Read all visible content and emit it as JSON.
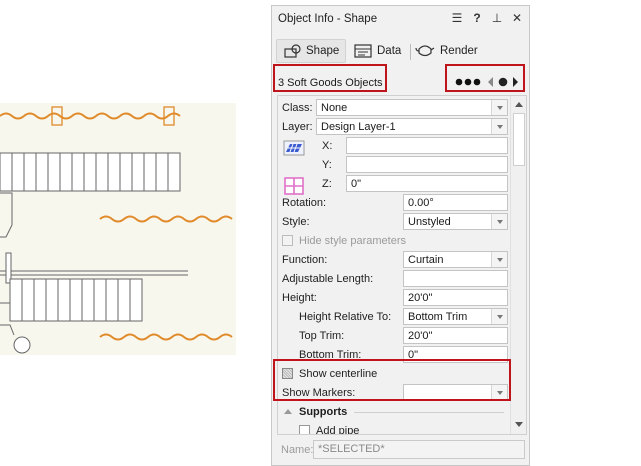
{
  "palette": {
    "title": "Object Info - Shape",
    "tabs": [
      {
        "label": "Shape",
        "icon": "shape-icon"
      },
      {
        "label": "Data",
        "icon": "data-icon"
      },
      {
        "label": "Render",
        "icon": "render-teapot-icon"
      }
    ]
  },
  "header": {
    "selection": "3 Soft Goods Objects",
    "nav_icons": [
      "more-dots-icon",
      "previous-icon",
      "gear-icon",
      "next-icon"
    ]
  },
  "fields": {
    "class": {
      "label": "Class:",
      "value": "None"
    },
    "layer": {
      "label": "Layer:",
      "value": "Design Layer-1"
    },
    "x": {
      "label": "X:",
      "value": ""
    },
    "y": {
      "label": "Y:",
      "value": ""
    },
    "z": {
      "label": "Z:",
      "value": "0\""
    },
    "rotation": {
      "label": "Rotation:",
      "value": "0.00°"
    },
    "style": {
      "label": "Style:",
      "value": "Unstyled"
    },
    "hide_style": {
      "label": "Hide style parameters"
    },
    "function": {
      "label": "Function:",
      "value": "Curtain"
    },
    "adjustable_length": {
      "label": "Adjustable Length:",
      "value": ""
    },
    "height": {
      "label": "Height:",
      "value": "20'0\""
    },
    "height_relative": {
      "label": "Height Relative To:",
      "value": "Bottom Trim"
    },
    "top_trim": {
      "label": "Top Trim:",
      "value": "20'0\""
    },
    "bottom_trim": {
      "label": "Bottom Trim:",
      "value": "0\""
    },
    "show_centerline": {
      "label": "Show centerline"
    },
    "show_markers": {
      "label": "Show Markers:",
      "value": ""
    },
    "supports": {
      "label": "Supports"
    },
    "add_pipe": {
      "label": "Add pipe"
    }
  },
  "namebar": {
    "label": "Name:",
    "value": "*SELECTED*"
  },
  "colors": {
    "highlight": "#c0141c",
    "drape": "#e08a2a",
    "canvas": "#f8f7ee"
  }
}
